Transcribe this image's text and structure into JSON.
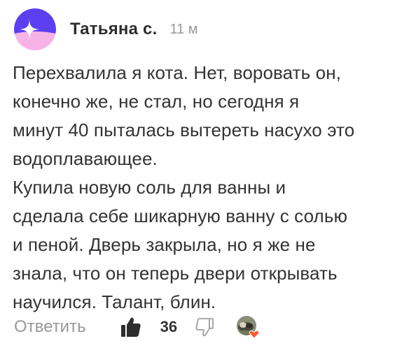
{
  "comment": {
    "author": "Татьяна с.",
    "time": "11 м",
    "lines": [
      "Перехвалила я кота. Нет, воровать он,",
      "конечно же, не стал, но сегодня я",
      "минут 40 пыталась вытереть насухо это",
      "водоплавающее.",
      "Купила новую соль для ванны и",
      "сделала себе шикарную ванну с солью",
      "и пеной. Дверь закрыла, но я же не",
      "знала, что он теперь двери открывать",
      "научился. Талант, блин."
    ],
    "actions": {
      "reply_label": "Ответить",
      "like_count": "36"
    },
    "icons": {
      "avatar": "zen-star-avatar",
      "like": "thumbs-up-icon",
      "dislike": "thumbs-down-icon",
      "reactor": "reactor-avatar-with-heart"
    },
    "colors": {
      "avatar_top": "#5b3ff0",
      "avatar_bottom": "#f7b3e8",
      "text": "#333333",
      "muted": "#999999",
      "heart": "#ff5a2d"
    }
  }
}
